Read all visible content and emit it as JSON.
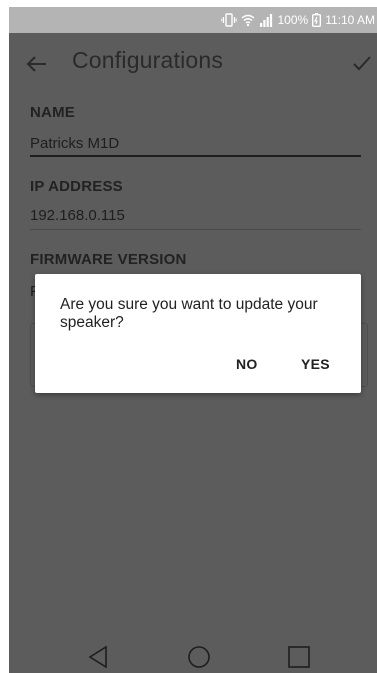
{
  "status_bar": {
    "battery": "100%",
    "time": "11:10 AM",
    "icons": [
      "vibrate-icon",
      "wifi-icon",
      "signal-icon",
      "battery-icon"
    ]
  },
  "app_bar": {
    "title": "Configurations",
    "back_icon": "arrow-left-icon",
    "confirm_icon": "check-icon"
  },
  "form": {
    "name_label": "NAME",
    "name_value": "Patricks M1D",
    "ip_label": "IP ADDRESS",
    "ip_value": "192.168.0.115",
    "firmware_label": "FIRMWARE VERSION",
    "firmware_value_partial": "F"
  },
  "dialog": {
    "message": "Are you sure you want to update your speaker?",
    "no_label": "NO",
    "yes_label": "YES"
  },
  "nav_bar": {
    "icons": [
      "nav-back-icon",
      "nav-home-icon",
      "nav-recents-icon"
    ]
  },
  "colors": {
    "status_bar": "#b4b4b4",
    "screen_dimmed": "#5c5c5c",
    "dialog_bg": "#ffffff",
    "text_dark": "#222222"
  }
}
